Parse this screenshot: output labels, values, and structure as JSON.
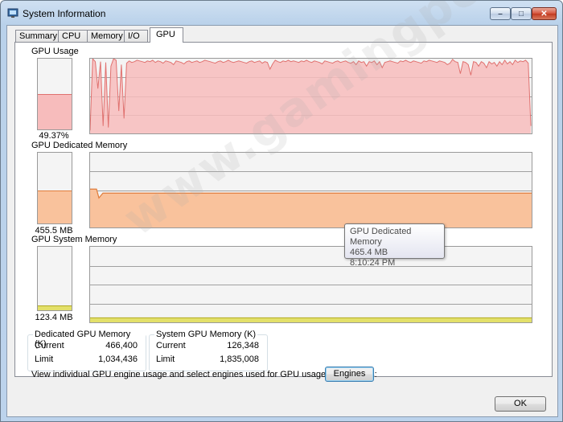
{
  "window": {
    "title": "System Information",
    "controls": {
      "minimize": "–",
      "maximize": "□",
      "close": "✕"
    }
  },
  "tabs": [
    {
      "label": "Summary",
      "active": false
    },
    {
      "label": "CPU",
      "active": false
    },
    {
      "label": "Memory",
      "active": false
    },
    {
      "label": "I/O",
      "active": false
    },
    {
      "label": "GPU",
      "active": true
    }
  ],
  "gpu_usage": {
    "label": "GPU Usage",
    "value_text": "49.37%",
    "level_fraction": 0.49,
    "fill_color": "#f7bcbc",
    "line_color": "#e0716f",
    "history_percent": [
      4,
      100,
      96,
      60,
      96,
      10,
      95,
      8,
      90,
      100,
      98,
      30,
      92,
      20,
      94,
      97,
      95,
      96,
      98,
      97,
      96,
      95,
      97,
      96,
      98,
      95,
      97,
      96,
      94,
      97,
      96,
      95,
      92,
      97,
      96,
      95,
      93,
      96,
      97,
      95,
      96,
      97,
      95,
      96,
      98,
      97,
      96,
      95,
      94,
      96,
      97,
      95,
      96,
      98,
      96,
      95,
      96,
      97,
      96,
      95,
      94,
      96,
      97,
      95,
      96,
      97,
      94,
      96,
      95,
      86,
      93,
      98,
      96,
      95,
      97,
      96,
      98,
      96,
      97,
      96,
      95,
      97,
      96,
      98,
      96,
      95,
      97,
      96,
      95,
      93,
      97,
      96,
      95,
      94,
      96,
      97,
      95,
      96,
      97,
      95,
      94,
      96,
      92,
      97,
      95,
      96,
      90,
      96,
      95,
      97,
      92,
      96,
      88,
      95,
      96,
      97,
      96,
      95,
      94,
      97,
      96,
      98,
      96,
      95,
      97,
      96,
      95,
      94,
      97,
      96,
      98,
      97,
      96,
      95,
      97,
      96,
      95,
      92,
      94,
      99,
      96,
      95,
      80,
      96,
      95,
      92,
      78,
      96,
      95,
      90,
      96,
      94,
      88,
      96,
      93,
      95,
      90,
      96,
      92,
      98,
      93,
      96,
      92,
      98,
      95,
      97,
      96,
      98,
      94,
      10
    ]
  },
  "gpu_dedicated_memory": {
    "label": "GPU Dedicated Memory",
    "value_text": "455.5 MB",
    "level_fraction": 0.46,
    "fill_color": "#f9c29c",
    "line_color": "#e07c3a"
  },
  "gpu_system_memory": {
    "label": "GPU System Memory",
    "value_text": "123.4 MB",
    "level_fraction": 0.06,
    "fill_color": "#e3e06a",
    "line_color": "#b0aa22"
  },
  "tooltip": {
    "title": "GPU Dedicated Memory",
    "value": "465.4 MB",
    "time": "8:10:24 PM"
  },
  "dedicated_group": {
    "title": "Dedicated GPU Memory (K)",
    "rows": [
      {
        "label": "Current",
        "value": "466,400"
      },
      {
        "label": "Limit",
        "value": "1,034,436"
      }
    ]
  },
  "system_group": {
    "title": "System GPU Memory (K)",
    "rows": [
      {
        "label": "Current",
        "value": "126,348"
      },
      {
        "label": "Limit",
        "value": "1,835,008"
      }
    ]
  },
  "engines": {
    "description": "View individual GPU engine usage and select engines used for GPU usage calculations:",
    "button_label": "Engines"
  },
  "ok_button": "OK",
  "watermark": "www.gamingpcbuilder.com"
}
